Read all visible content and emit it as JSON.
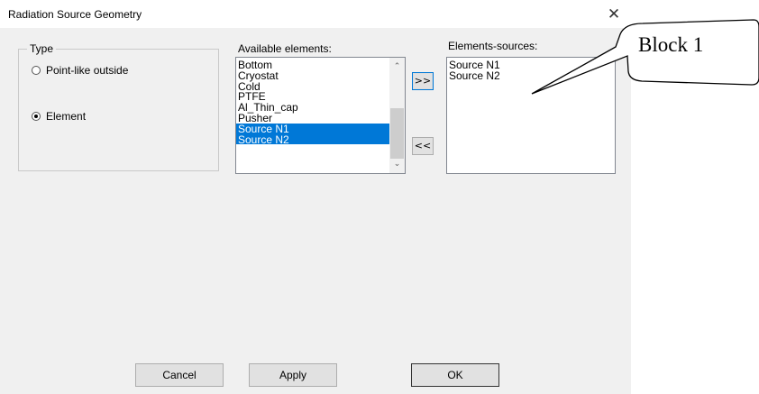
{
  "window": {
    "title": "Radiation Source Geometry",
    "close_glyph": "✕"
  },
  "type_group": {
    "legend": "Type",
    "options": [
      {
        "label": "Point-like outside",
        "checked": false
      },
      {
        "label": "Element",
        "checked": true
      }
    ]
  },
  "available": {
    "label": "Available elements:",
    "items": [
      {
        "text": "Bottom",
        "selected": false
      },
      {
        "text": "Cryostat",
        "selected": false
      },
      {
        "text": "Cold",
        "selected": false
      },
      {
        "text": "PTFE",
        "selected": false
      },
      {
        "text": "Al_Thin_cap",
        "selected": false
      },
      {
        "text": "Pusher",
        "selected": false
      },
      {
        "text": "Source N1",
        "selected": true
      },
      {
        "text": "Source N2",
        "selected": true
      }
    ],
    "scroll_up_glyph": "⌃",
    "scroll_down_glyph": "⌄"
  },
  "transfer": {
    "add_label": ">>",
    "remove_label": "<<"
  },
  "sources": {
    "label": "Elements-sources:",
    "items": [
      "Source N1",
      "Source N2"
    ]
  },
  "footer": {
    "cancel_label": "Cancel",
    "apply_label": "Apply",
    "ok_label": "OK"
  },
  "annotation": {
    "text": "Block 1"
  }
}
